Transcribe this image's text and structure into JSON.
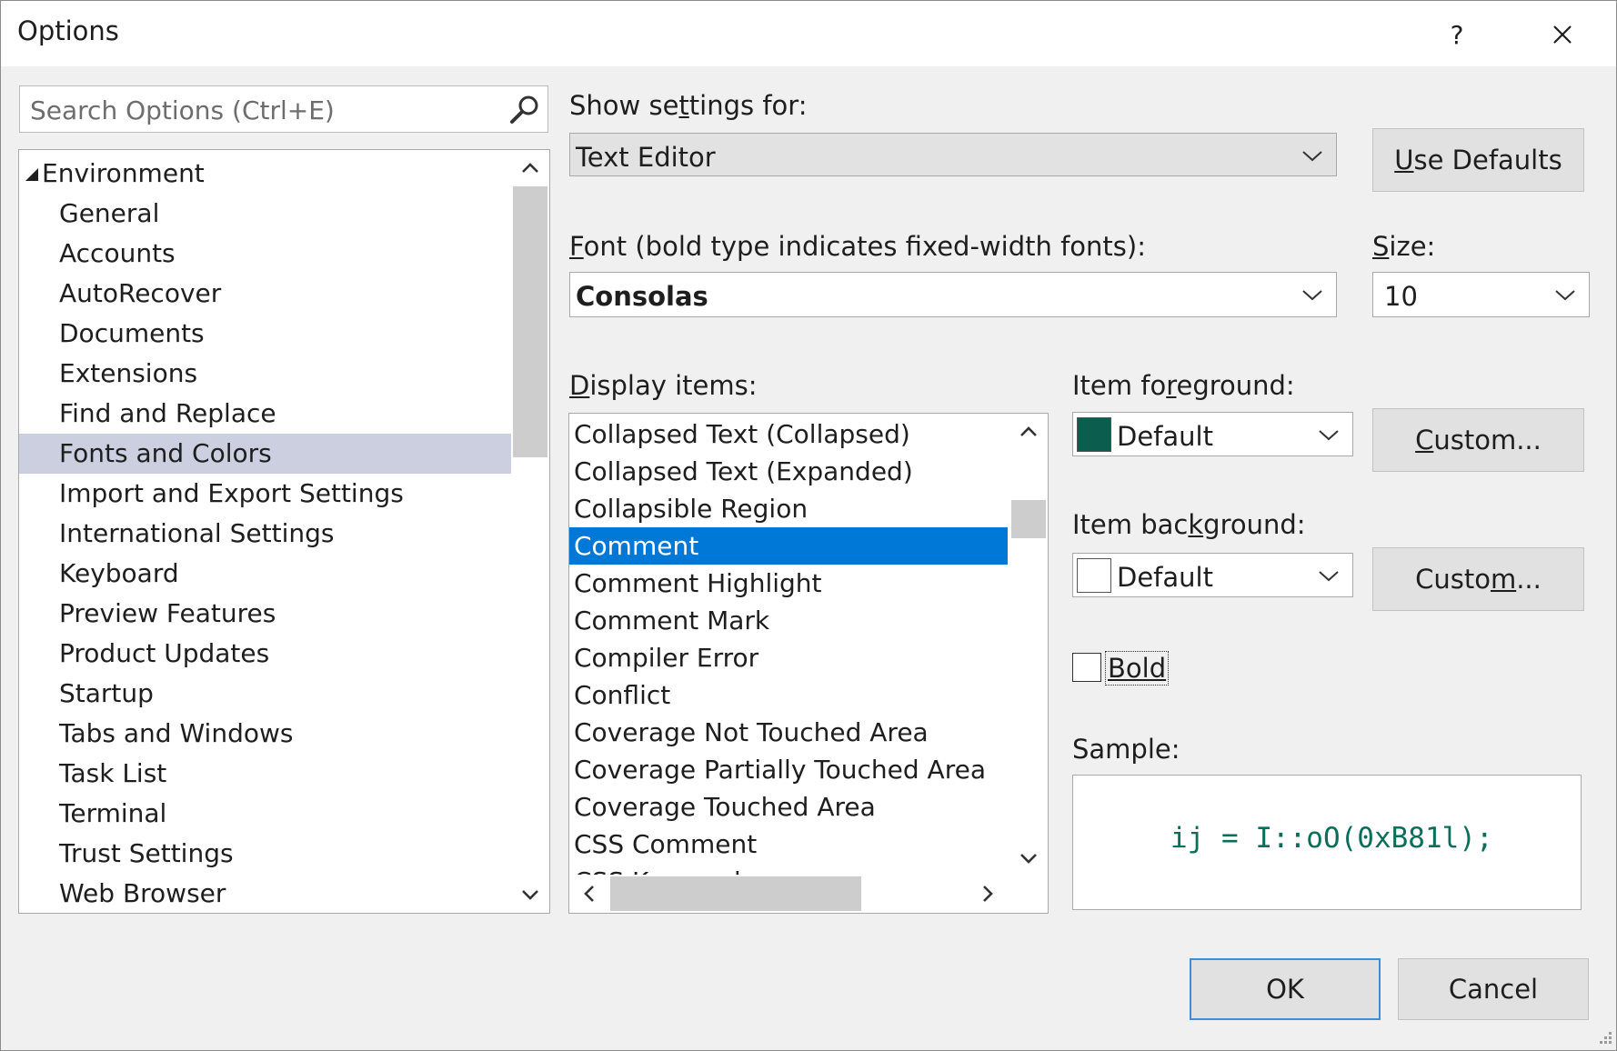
{
  "window": {
    "title": "Options",
    "help_label": "?",
    "close_label": "✕"
  },
  "search": {
    "placeholder": "Search Options (Ctrl+E)"
  },
  "tree": {
    "root": "Environment",
    "selected": "Fonts and Colors",
    "items": [
      "General",
      "Accounts",
      "AutoRecover",
      "Documents",
      "Extensions",
      "Find and Replace",
      "Fonts and Colors",
      "Import and Export Settings",
      "International Settings",
      "Keyboard",
      "Preview Features",
      "Product Updates",
      "Startup",
      "Tabs and Windows",
      "Task List",
      "Terminal",
      "Trust Settings",
      "Web Browser"
    ]
  },
  "settings": {
    "show_for_pre": "Show se",
    "show_for_u": "t",
    "show_for_post": "tings for:",
    "show_for_value": "Text Editor",
    "use_defaults_u": "U",
    "use_defaults_rest": "se Defaults"
  },
  "font": {
    "label_u": "F",
    "label_rest": "ont (bold type indicates fixed-width fonts):",
    "value": "Consolas",
    "size_label_u": "S",
    "size_label_rest": "ize:",
    "size_value": "10"
  },
  "display_items": {
    "label_u": "D",
    "label_rest": "isplay items:",
    "selected": "Comment",
    "items": [
      "Collapsed Text (Collapsed)",
      "Collapsed Text (Expanded)",
      "Collapsible Region",
      "Comment",
      "Comment Highlight",
      "Comment Mark",
      "Compiler Error",
      "Conflict",
      "Coverage Not Touched Area",
      "Coverage Partially Touched Area",
      "Coverage Touched Area",
      "CSS Comment",
      "CSS Keyword"
    ]
  },
  "foreground": {
    "label_pre": "Item fo",
    "label_u": "r",
    "label_post": "eground:",
    "value": "Default",
    "swatch_color": "#0b5e4e",
    "custom_u": "C",
    "custom_rest": "ustom..."
  },
  "background": {
    "label_pre": "Item bac",
    "label_u": "k",
    "label_post": "ground:",
    "value": "Default",
    "swatch_color": "#ffffff",
    "custom_pre": "Custo",
    "custom_u": "m",
    "custom_post": "..."
  },
  "bold": {
    "label": "Bold",
    "checked": false
  },
  "sample": {
    "label": "Sample:",
    "text": "ij = I::oO(0xB81l);",
    "color": "#0b6e5b"
  },
  "buttons": {
    "ok": "OK",
    "cancel": "Cancel"
  }
}
